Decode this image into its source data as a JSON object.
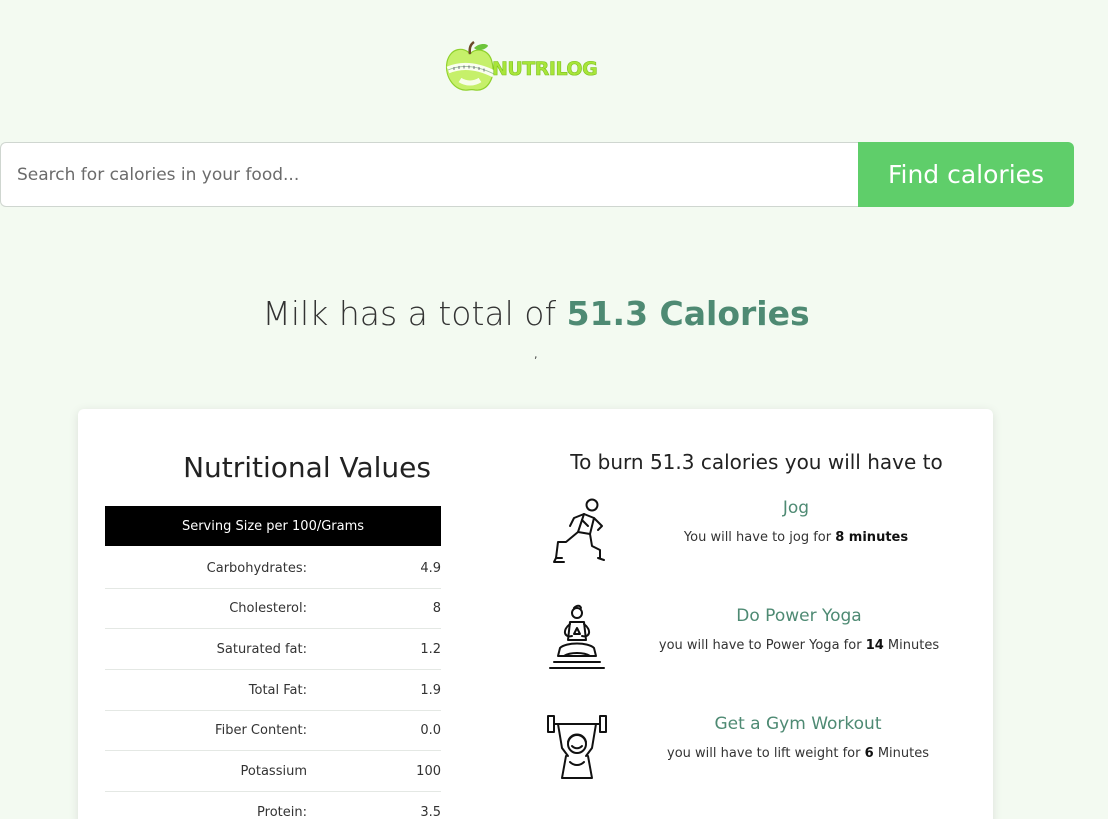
{
  "brand": {
    "name": "NUTRILOG"
  },
  "search": {
    "placeholder": "Search for calories in your food...",
    "button_label": "Find calories"
  },
  "headline": {
    "food": "Milk",
    "middle": "has a total of",
    "calories": "51.3 Calories",
    "note": ","
  },
  "nutrition": {
    "title": "Nutritional Values",
    "serving": "Serving Size per 100/Grams",
    "rows": [
      {
        "label": "Carbohydrates:",
        "value": "4.9"
      },
      {
        "label": "Cholesterol:",
        "value": "8"
      },
      {
        "label": "Saturated fat:",
        "value": "1.2"
      },
      {
        "label": "Total Fat:",
        "value": "1.9"
      },
      {
        "label": "Fiber Content:",
        "value": "0.0"
      },
      {
        "label": "Potassium",
        "value": "100"
      },
      {
        "label": "Protein:",
        "value": "3.5"
      }
    ]
  },
  "burn": {
    "title": "To burn 51.3 calories you will have to",
    "activities": [
      {
        "icon": "jogger-icon",
        "name": "Jog",
        "prefix": "You will have to jog for",
        "amount": "8 minutes",
        "suffix": ""
      },
      {
        "icon": "yoga-icon",
        "name": "Do Power Yoga",
        "prefix": "you will have to Power Yoga for",
        "amount": "14",
        "suffix": "Minutes"
      },
      {
        "icon": "weightlifter-icon",
        "name": "Get a Gym Workout",
        "prefix": "you will have to lift weight for",
        "amount": "6",
        "suffix": "Minutes"
      }
    ]
  },
  "colors": {
    "background": "#f3faf1",
    "accent_green": "#5fce6a",
    "calorie_text": "#4e8a73",
    "logo_green": "#a8e53a"
  }
}
